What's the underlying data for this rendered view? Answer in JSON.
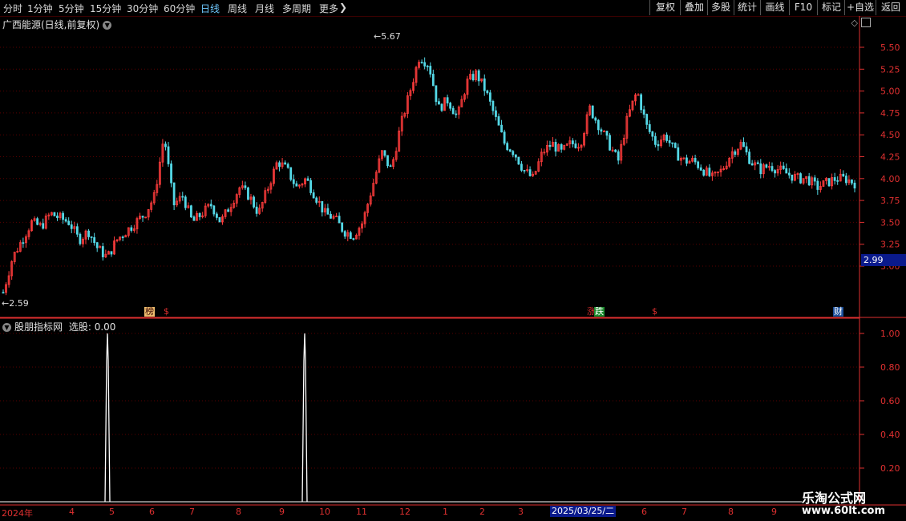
{
  "toolbar": {
    "periods": [
      "分时",
      "1分钟",
      "5分钟",
      "15分钟",
      "30分钟",
      "60分钟",
      "日线",
      "周线",
      "月线",
      "多周期",
      "更多"
    ],
    "active": "日线",
    "buttons": [
      "复权",
      "叠加",
      "多股",
      "统计",
      "画线",
      "F10",
      "标记",
      "+自选",
      "返回"
    ]
  },
  "chart_title": "广西能源(日线,前复权)",
  "price_axis": [
    "5.50",
    "5.25",
    "5.00",
    "4.75",
    "4.50",
    "4.25",
    "4.00",
    "3.75",
    "3.50",
    "3.25",
    "3.00"
  ],
  "current_price": "2.99",
  "annotations": {
    "high": "5.67",
    "low": "2.59"
  },
  "markers": [
    "榜",
    "$",
    "涨",
    "跌",
    "$",
    "财"
  ],
  "indicator": {
    "title": "股朋指标网",
    "label": "选股: 0.00",
    "axis": [
      "1.00",
      "0.80",
      "0.60",
      "0.40",
      "0.20"
    ]
  },
  "date_axis": [
    "2024年",
    "4",
    "5",
    "6",
    "7",
    "8",
    "9",
    "10",
    "11",
    "12",
    "1",
    "2",
    "3",
    "6",
    "7",
    "8",
    "9"
  ],
  "cursor_date": "2025/03/25/二",
  "watermark": {
    "line1": "乐淘公式网",
    "line2": "www.60lt.com"
  },
  "chart_data": {
    "type": "candlestick",
    "title": "广西能源(日线,前复权)",
    "ylim": [
      2.59,
      5.67
    ],
    "high": 5.67,
    "low": 2.59,
    "last": 2.99,
    "close_path": [
      2.7,
      3.1,
      3.3,
      3.5,
      3.45,
      3.6,
      3.55,
      3.5,
      3.3,
      3.4,
      3.2,
      3.1,
      3.3,
      3.4,
      3.5,
      3.6,
      3.8,
      4.5,
      3.7,
      3.8,
      3.5,
      3.6,
      3.7,
      3.5,
      3.7,
      3.9,
      3.8,
      3.6,
      3.9,
      4.2,
      4.1,
      3.9,
      4.0,
      3.8,
      3.6,
      3.55,
      3.4,
      3.35,
      3.5,
      3.9,
      4.3,
      4.1,
      4.6,
      5.0,
      5.4,
      5.3,
      4.8,
      4.9,
      4.7,
      5.1,
      5.2,
      5.0,
      4.7,
      4.4,
      4.3,
      4.1,
      4.0,
      4.3,
      4.4,
      4.3,
      4.4,
      4.4,
      4.8,
      4.6,
      4.4,
      4.2,
      4.7,
      5.0,
      4.6,
      4.4,
      4.5,
      4.3,
      4.2,
      4.2,
      4.1,
      4.0,
      4.1,
      4.3,
      4.4,
      4.2,
      4.1,
      4.15,
      4.1,
      4.05,
      4.0,
      4.0,
      3.9,
      3.95,
      4.0,
      4.0,
      3.95
    ],
    "indicator_signals": [
      0,
      0,
      1,
      0,
      1,
      0
    ],
    "indicator_ylim": [
      0,
      1
    ]
  }
}
